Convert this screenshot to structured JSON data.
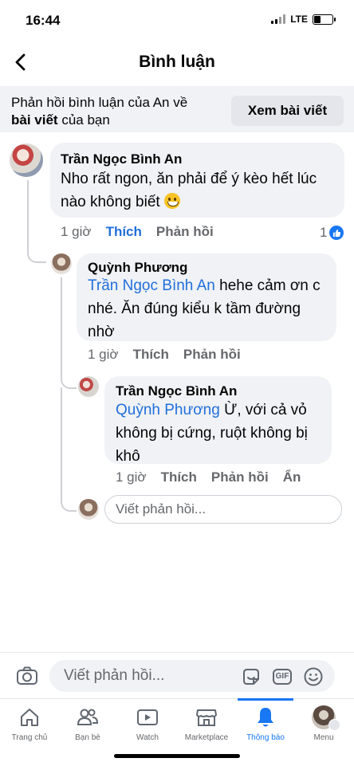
{
  "status": {
    "time": "16:44",
    "network": "LTE"
  },
  "header": {
    "title": "Bình luận"
  },
  "context": {
    "text_prefix": "Phản hồi bình luận của An về",
    "text_bold": "bài viết",
    "text_suffix": " của bạn",
    "view_post_label": "Xem bài viết"
  },
  "comments": [
    {
      "author": "Trần Ngọc Bình An",
      "text_line1": "Nho rất ngon, ăn phải để ý kèo hết lúc",
      "text_line2": "nào không biết",
      "emoji": "grinning-face",
      "time": "1 giờ",
      "like_label": "Thích",
      "reply_label": "Phản hồi",
      "like_count": "1"
    },
    {
      "author": "Quỳnh Phương",
      "mention": "Trần Ngọc Bình An",
      "text_line1": " hehe cảm ơn c",
      "text_line2": "nhé. Ăn đúng kiểu k tầm đường",
      "text_line3": "nhờ",
      "time": "1 giờ",
      "like_label": "Thích",
      "reply_label": "Phản hồi"
    },
    {
      "author": "Trần Ngọc Bình An",
      "mention": "Quỳnh Phương",
      "text_line1": " Ừ, với cả vỏ",
      "text_line2": "không bị cứng, ruột không bị",
      "text_line3": "khô",
      "time": "1 giờ",
      "like_label": "Thích",
      "reply_label": "Phản hồi",
      "hide_label": "Ẩn"
    }
  ],
  "reply_box": {
    "placeholder": "Viết phản hồi..."
  },
  "composer": {
    "placeholder": "Viết phản hồi...",
    "gif_label": "GIF"
  },
  "tabs": [
    {
      "label": "Trang chủ",
      "icon": "home-icon"
    },
    {
      "label": "Bạn bè",
      "icon": "friends-icon"
    },
    {
      "label": "Watch",
      "icon": "watch-icon"
    },
    {
      "label": "Marketplace",
      "icon": "marketplace-icon"
    },
    {
      "label": "Thông báo",
      "icon": "bell-icon",
      "active": true
    },
    {
      "label": "Menu",
      "icon": "menu-avatar"
    }
  ],
  "colors": {
    "accent": "#1877f2",
    "mention": "#216fdb",
    "bubble": "#f0f2f5"
  }
}
